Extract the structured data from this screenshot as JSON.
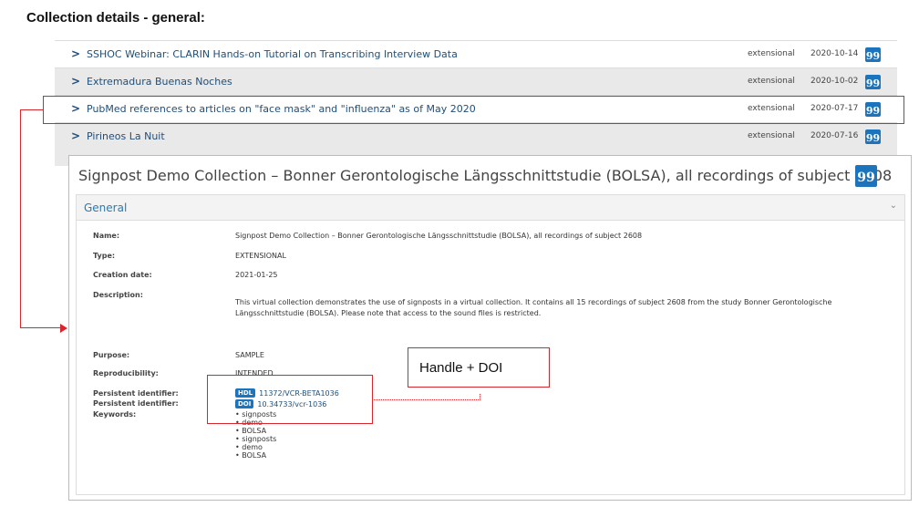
{
  "heading": "Collection details - general:",
  "collections": [
    {
      "title": "SSHOC Webinar: CLARIN Hands-on Tutorial on Transcribing Interview Data",
      "type": "extensional",
      "date": "2020-10-14",
      "cite": "99"
    },
    {
      "title": "Extremadura Buenas Noches",
      "type": "extensional",
      "date": "2020-10-02",
      "cite": "99"
    },
    {
      "title": "PubMed references to articles on \"face mask\" and \"influenza\" as of May 2020",
      "type": "extensional",
      "date": "2020-07-17",
      "cite": "99"
    },
    {
      "title": "Pirineos La Nuit",
      "type": "extensional",
      "date": "2020-07-16",
      "cite": "99"
    }
  ],
  "detail": {
    "title": "Signpost Demo Collection – Bonner Gerontologische Längsschnittstudie (BOLSA), all recordings of subject 2608",
    "cite": "99",
    "section": "General",
    "fields": {
      "name_label": "Name:",
      "name_value": "Signpost Demo Collection – Bonner Gerontologische Längsschnittstudie (BOLSA), all recordings of subject 2608",
      "type_label": "Type:",
      "type_value": "EXTENSIONAL",
      "creation_label": "Creation date:",
      "creation_value": "2021-01-25",
      "description_label": "Description:",
      "description_value": "This virtual collection demonstrates the use of signposts in a virtual collection. It contains all 15 recordings of subject 2608 from the study Bonner Gerontologische Längsschnittstudie (BOLSA). Please note that access to the sound files is restricted.",
      "purpose_label": "Purpose:",
      "purpose_value": "SAMPLE",
      "reproducibility_label": "Reproducibility:",
      "reproducibility_value": "INTENDED",
      "pid1_label": "Persistent identifier:",
      "pid1_badge": "HDL",
      "pid1_value": "11372/VCR-BETA1036",
      "pid2_label": "Persistent identifier:",
      "pid2_badge": "DOI",
      "pid2_value": "10.34733/vcr-1036",
      "keywords_label": "Keywords:",
      "keywords": [
        "signposts",
        "demo",
        "BOLSA",
        "signposts",
        "demo",
        "BOLSA"
      ]
    }
  },
  "callout": "Handle + DOI",
  "colors": {
    "annotation": "#d9262b",
    "link": "#1f4e79",
    "accent": "#1c75bc"
  }
}
